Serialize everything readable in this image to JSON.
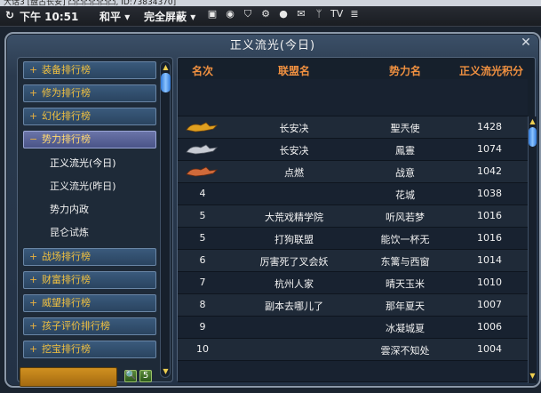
{
  "system_bar": {
    "window_caption": "大话3 [盘古长安] 凸凸凸凸凸凸, ID:73834370]",
    "time": "下午 10:51",
    "mode": "和平",
    "block": "完全屏蔽",
    "dropdown_arrow": "▾",
    "tv": "TV"
  },
  "panel": {
    "title": "正义流光(今日)",
    "close": "✕"
  },
  "nav": {
    "items": [
      {
        "label": "装备排行榜",
        "mark": "+"
      },
      {
        "label": "修为排行榜",
        "mark": "+"
      },
      {
        "label": "幻化排行榜",
        "mark": "+"
      },
      {
        "label": "势力排行榜",
        "mark": "−"
      },
      {
        "label": "战场排行榜",
        "mark": "+"
      },
      {
        "label": "财富排行榜",
        "mark": "+"
      },
      {
        "label": "威望排行榜",
        "mark": "+"
      },
      {
        "label": "孩子评价排行榜",
        "mark": "+"
      },
      {
        "label": "挖宝排行榜",
        "mark": "+"
      }
    ],
    "subitems": [
      {
        "label": "正义流光(今日)"
      },
      {
        "label": "正义流光(昨日)"
      },
      {
        "label": "势力内政"
      },
      {
        "label": "昆仑试炼"
      }
    ]
  },
  "table": {
    "headers": [
      "名次",
      "联盟名",
      "势力名",
      "正义流光积分"
    ],
    "rows": [
      {
        "rank": "",
        "alliance": "",
        "faction": "",
        "score": ""
      },
      {
        "rank": "1",
        "alliance": "长安决",
        "faction": "聖兲使",
        "score": "1428"
      },
      {
        "rank": "2",
        "alliance": "长安决",
        "faction": "鳳霻",
        "score": "1074"
      },
      {
        "rank": "3",
        "alliance": "点燃",
        "faction": "战意",
        "score": "1042"
      },
      {
        "rank": "4",
        "alliance": "",
        "faction": "花城",
        "score": "1038"
      },
      {
        "rank": "5",
        "alliance": "大荒戏精学院",
        "faction": "听风若梦",
        "score": "1016"
      },
      {
        "rank": "5",
        "alliance": "打狗联盟",
        "faction": "能饮一杯无",
        "score": "1016"
      },
      {
        "rank": "6",
        "alliance": "厉害死了叉会妖",
        "faction": "东篱与西窗",
        "score": "1014"
      },
      {
        "rank": "7",
        "alliance": "杭州人家",
        "faction": "晴天玉米",
        "score": "1010"
      },
      {
        "rank": "8",
        "alliance": "副本去哪儿了",
        "faction": "那年夏天",
        "score": "1007"
      },
      {
        "rank": "9",
        "alliance": "",
        "faction": "冰凝城夏",
        "score": "1006"
      },
      {
        "rank": "10",
        "alliance": "",
        "faction": "雲深不知处",
        "score": "1004"
      }
    ]
  },
  "bottom": {
    "search_icon": "🔍",
    "reset_icon": "5"
  },
  "colors": {
    "header_text": "#f09040",
    "nav_text": "#f0c040",
    "panel_bg": "#233246"
  }
}
